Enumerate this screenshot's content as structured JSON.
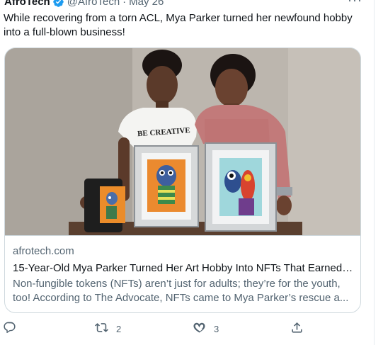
{
  "tweet": {
    "author": "AfroTech",
    "handle": "@AfroTech",
    "separator": "·",
    "date": "May 26",
    "more_label": "···",
    "text": "While recovering from a torn ACL, Mya Parker turned her newfound hobby into a full-blown business!"
  },
  "card": {
    "domain": "afrotech.com",
    "title": "15-Year-Old Mya Parker Turned Her Art Hobby Into NFTs That Earned ...",
    "description": "Non-fungible tokens (NFTs) aren’t just for adults; they’re for the youth, too! According to The Advocate, NFTs came to Mya Parker’s rescue a...",
    "shirt_text": "BE CREATIVE"
  },
  "actions": {
    "reply_count": "",
    "retweet_count": "2",
    "like_count": "3",
    "share_count": ""
  },
  "icons": {
    "verified": "verified-badge-icon",
    "reply": "reply-icon",
    "retweet": "retweet-icon",
    "like": "heart-icon",
    "share": "share-icon"
  },
  "colors": {
    "verified_blue": "#1d9bf0",
    "text_primary": "#0f1419",
    "text_secondary": "#536471",
    "border": "#cfd9de"
  }
}
